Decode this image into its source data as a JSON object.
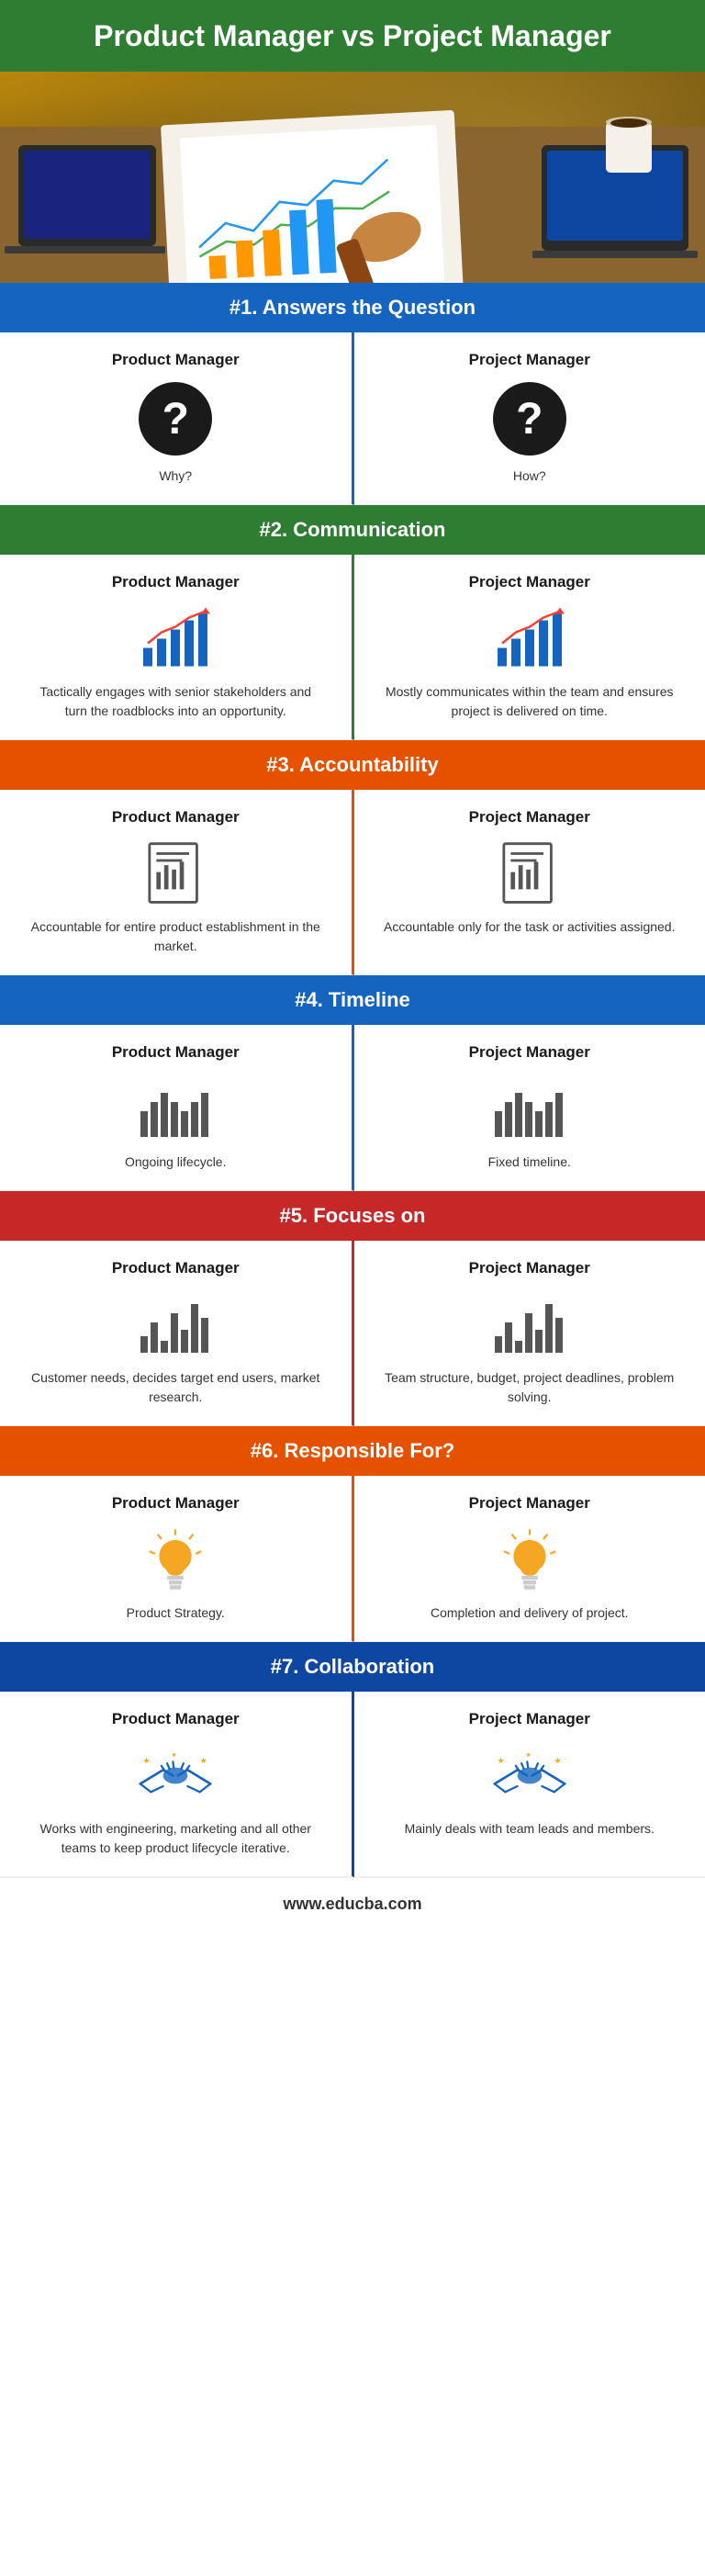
{
  "header": {
    "title": "Product Manager vs Project Manager"
  },
  "sections": [
    {
      "id": "section1",
      "number": "#1.",
      "title": "Answers the Question",
      "color": "blue",
      "left": {
        "label": "Product Manager",
        "icon": "question",
        "text": "Why?"
      },
      "right": {
        "label": "Project Manager",
        "icon": "question",
        "text": "How?"
      }
    },
    {
      "id": "section2",
      "number": "#2.",
      "title": "Communication",
      "color": "green",
      "left": {
        "label": "Product Manager",
        "icon": "chart-up",
        "text": "Tactically engages with senior stakeholders and turn the roadblocks into an opportunity."
      },
      "right": {
        "label": "Project Manager",
        "icon": "chart-up",
        "text": "Mostly communicates within the team and ensures project is delivered on time."
      }
    },
    {
      "id": "section3",
      "number": "#3.",
      "title": "Accountability",
      "color": "orange",
      "left": {
        "label": "Product Manager",
        "icon": "document",
        "text": "Accountable for entire product establishment in the market."
      },
      "right": {
        "label": "Project Manager",
        "icon": "document",
        "text": "Accountable only for the task or activities assigned."
      }
    },
    {
      "id": "section4",
      "number": "#4.",
      "title": "Timeline",
      "color": "blue",
      "left": {
        "label": "Product Manager",
        "icon": "timeline",
        "text": "Ongoing lifecycle."
      },
      "right": {
        "label": "Project Manager",
        "icon": "timeline",
        "text": "Fixed timeline."
      }
    },
    {
      "id": "section5",
      "number": "#5.",
      "title": "Focuses on",
      "color": "red",
      "left": {
        "label": "Product Manager",
        "icon": "bars",
        "text": "Customer needs, decides target end users, market research."
      },
      "right": {
        "label": "Project Manager",
        "icon": "bars",
        "text": "Team structure, budget, project deadlines, problem solving."
      }
    },
    {
      "id": "section6",
      "number": "#6.",
      "title": "Responsible For?",
      "color": "orange",
      "left": {
        "label": "Product Manager",
        "icon": "lightbulb",
        "text": "Product Strategy."
      },
      "right": {
        "label": "Project Manager",
        "icon": "lightbulb",
        "text": "Completion and delivery of project."
      }
    },
    {
      "id": "section7",
      "number": "#7.",
      "title": "Collaboration",
      "color": "dark-blue",
      "left": {
        "label": "Product Manager",
        "icon": "handshake",
        "text": "Works with engineering, marketing and all other teams to keep product lifecycle iterative."
      },
      "right": {
        "label": "Project Manager",
        "icon": "handshake",
        "text": "Mainly deals with team leads and members."
      }
    }
  ],
  "footer": {
    "url": "www.educba.com"
  }
}
